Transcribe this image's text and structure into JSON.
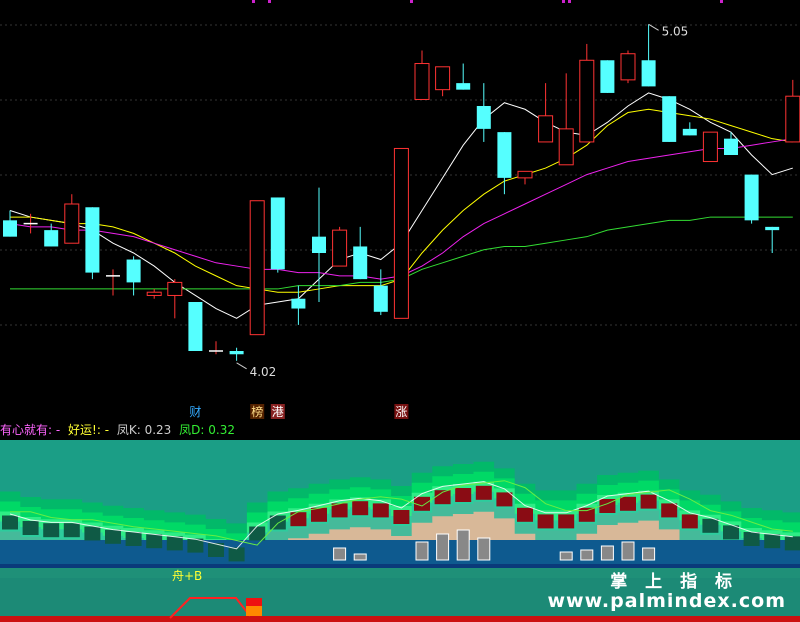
{
  "chart_data": {
    "type": "candlestick",
    "ylim": [
      3.9,
      5.1
    ],
    "candles": [
      {
        "o": 4.45,
        "h": 4.48,
        "l": 4.4,
        "c": 4.4
      },
      {
        "o": 4.44,
        "h": 4.47,
        "l": 4.41,
        "c": 4.44
      },
      {
        "o": 4.42,
        "h": 4.44,
        "l": 4.37,
        "c": 4.37
      },
      {
        "o": 4.38,
        "h": 4.53,
        "l": 4.38,
        "c": 4.5
      },
      {
        "o": 4.49,
        "h": 4.49,
        "l": 4.27,
        "c": 4.29
      },
      {
        "o": 4.28,
        "h": 4.3,
        "l": 4.22,
        "c": 4.28
      },
      {
        "o": 4.33,
        "h": 4.34,
        "l": 4.22,
        "c": 4.26
      },
      {
        "o": 4.22,
        "h": 4.24,
        "l": 4.21,
        "c": 4.23
      },
      {
        "o": 4.22,
        "h": 4.27,
        "l": 4.15,
        "c": 4.26
      },
      {
        "o": 4.2,
        "h": 4.2,
        "l": 4.05,
        "c": 4.05
      },
      {
        "o": 4.05,
        "h": 4.08,
        "l": 4.04,
        "c": 4.05
      },
      {
        "o": 4.05,
        "h": 4.06,
        "l": 4.02,
        "c": 4.04
      },
      {
        "o": 4.1,
        "h": 4.51,
        "l": 4.1,
        "c": 4.51
      },
      {
        "o": 4.52,
        "h": 4.52,
        "l": 4.29,
        "c": 4.3
      },
      {
        "o": 4.21,
        "h": 4.25,
        "l": 4.13,
        "c": 4.18
      },
      {
        "o": 4.4,
        "h": 4.55,
        "l": 4.2,
        "c": 4.35
      },
      {
        "o": 4.31,
        "h": 4.43,
        "l": 4.31,
        "c": 4.42
      },
      {
        "o": 4.37,
        "h": 4.43,
        "l": 4.27,
        "c": 4.27
      },
      {
        "o": 4.25,
        "h": 4.3,
        "l": 4.16,
        "c": 4.17
      },
      {
        "o": 4.15,
        "h": 4.67,
        "l": 4.15,
        "c": 4.67
      },
      {
        "o": 4.82,
        "h": 4.97,
        "l": 4.82,
        "c": 4.93
      },
      {
        "o": 4.85,
        "h": 4.92,
        "l": 4.83,
        "c": 4.92
      },
      {
        "o": 4.87,
        "h": 4.93,
        "l": 4.85,
        "c": 4.85
      },
      {
        "o": 4.8,
        "h": 4.87,
        "l": 4.69,
        "c": 4.73
      },
      {
        "o": 4.72,
        "h": 4.72,
        "l": 4.53,
        "c": 4.58
      },
      {
        "o": 4.58,
        "h": 4.6,
        "l": 4.56,
        "c": 4.6
      },
      {
        "o": 4.69,
        "h": 4.87,
        "l": 4.69,
        "c": 4.77
      },
      {
        "o": 4.62,
        "h": 4.9,
        "l": 4.62,
        "c": 4.73
      },
      {
        "o": 4.69,
        "h": 4.99,
        "l": 4.69,
        "c": 4.94
      },
      {
        "o": 4.94,
        "h": 4.94,
        "l": 4.84,
        "c": 4.84
      },
      {
        "o": 4.88,
        "h": 4.97,
        "l": 4.87,
        "c": 4.96
      },
      {
        "o": 4.94,
        "h": 5.05,
        "l": 4.86,
        "c": 4.86
      },
      {
        "o": 4.83,
        "h": 4.83,
        "l": 4.69,
        "c": 4.69
      },
      {
        "o": 4.73,
        "h": 4.75,
        "l": 4.71,
        "c": 4.71
      },
      {
        "o": 4.63,
        "h": 4.72,
        "l": 4.63,
        "c": 4.72
      },
      {
        "o": 4.7,
        "h": 4.72,
        "l": 4.65,
        "c": 4.65
      },
      {
        "o": 4.59,
        "h": 4.59,
        "l": 4.44,
        "c": 4.45
      },
      {
        "o": 4.43,
        "h": 4.43,
        "l": 4.35,
        "c": 4.42
      },
      {
        "o": 4.69,
        "h": 4.88,
        "l": 4.69,
        "c": 4.83
      }
    ],
    "ma": [
      {
        "color": "#ffffff",
        "values": [
          4.48,
          4.46,
          4.45,
          4.44,
          4.42,
          4.38,
          4.35,
          4.31,
          4.26,
          4.22,
          4.18,
          4.15,
          4.19,
          4.2,
          4.21,
          4.27,
          4.33,
          4.35,
          4.33,
          4.38,
          4.48,
          4.58,
          4.68,
          4.76,
          4.81,
          4.79,
          4.75,
          4.72,
          4.71,
          4.75,
          4.8,
          4.84,
          4.82,
          4.79,
          4.75,
          4.72,
          4.65,
          4.59,
          4.61
        ]
      },
      {
        "color": "#ffff00",
        "values": [
          4.46,
          4.46,
          4.45,
          4.44,
          4.44,
          4.43,
          4.41,
          4.38,
          4.35,
          4.31,
          4.28,
          4.25,
          4.24,
          4.23,
          4.23,
          4.24,
          4.25,
          4.25,
          4.25,
          4.27,
          4.35,
          4.42,
          4.48,
          4.53,
          4.57,
          4.59,
          4.61,
          4.64,
          4.68,
          4.74,
          4.78,
          4.79,
          4.78,
          4.77,
          4.76,
          4.74,
          4.72,
          4.7,
          4.69
        ]
      },
      {
        "color": "#ee22ee",
        "values": [
          4.44,
          4.43,
          4.43,
          4.42,
          4.42,
          4.41,
          4.4,
          4.38,
          4.36,
          4.34,
          4.32,
          4.31,
          4.3,
          4.3,
          4.29,
          4.29,
          4.28,
          4.28,
          4.27,
          4.28,
          4.31,
          4.35,
          4.4,
          4.44,
          4.47,
          4.5,
          4.53,
          4.56,
          4.59,
          4.61,
          4.63,
          4.64,
          4.65,
          4.66,
          4.67,
          4.67,
          4.68,
          4.69,
          4.7
        ]
      },
      {
        "color": "#33dd33",
        "values": [
          4.24,
          4.24,
          4.24,
          4.24,
          4.24,
          4.24,
          4.24,
          4.24,
          4.24,
          4.24,
          4.24,
          4.24,
          4.24,
          4.24,
          4.25,
          4.25,
          4.25,
          4.26,
          4.26,
          4.27,
          4.3,
          4.32,
          4.34,
          4.36,
          4.37,
          4.37,
          4.38,
          4.39,
          4.4,
          4.42,
          4.43,
          4.44,
          4.45,
          4.45,
          4.46,
          4.46,
          4.46,
          4.46,
          4.46
        ]
      }
    ],
    "annotations": {
      "high_label": "5.05",
      "low_label": "4.02"
    },
    "event_markers": [
      {
        "index": 9,
        "text": "财",
        "color": "#33aaff",
        "bg": "none"
      },
      {
        "index": 12,
        "text": "榜",
        "color": "#ffdd88",
        "bg": "#552200"
      },
      {
        "index": 13,
        "text": "港",
        "color": "#ffffff",
        "bg": "#882222"
      },
      {
        "index": 19,
        "text": "涨",
        "color": "#ffffff",
        "bg": "#771111"
      }
    ],
    "sub_panel": {
      "k_value": "0.23",
      "d_value": "0.32",
      "signal_label": "舟+B",
      "bands": [
        0.55,
        0.5,
        0.48,
        0.48,
        0.45,
        0.42,
        0.4,
        0.38,
        0.36,
        0.34,
        0.3,
        0.26,
        0.45,
        0.55,
        0.58,
        0.62,
        0.66,
        0.68,
        0.66,
        0.6,
        0.72,
        0.78,
        0.8,
        0.82,
        0.76,
        0.62,
        0.56,
        0.56,
        0.62,
        0.7,
        0.72,
        0.74,
        0.66,
        0.56,
        0.52,
        0.46,
        0.4,
        0.38,
        0.36
      ]
    }
  },
  "indicator_bar": {
    "label1": "有心就有: -",
    "label2": "好运!: -",
    "label3": "凤K: 0.23",
    "label4": "凤D: 0.32"
  },
  "watermark": {
    "cn": "掌 上 指 标",
    "url": "www.palmindex.com"
  }
}
